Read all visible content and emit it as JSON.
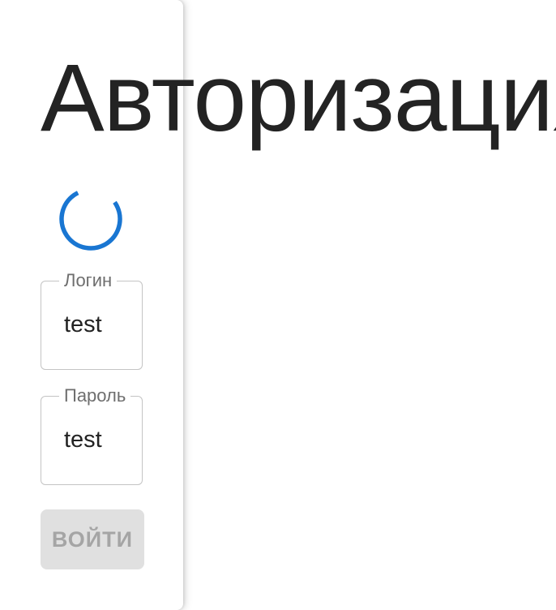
{
  "page": {
    "title": "Авторизация"
  },
  "form": {
    "login": {
      "label": "Логин",
      "value": "test"
    },
    "password": {
      "label": "Пароль",
      "value": "test"
    },
    "submit_label": "ВОЙТИ",
    "submit_disabled": true,
    "loading": true
  },
  "colors": {
    "spinner": "#1976d2",
    "title_text": "#232323",
    "field_border": "#c4c4c4",
    "label_text": "#6e6e6e",
    "disabled_button_bg": "#e0e0e0",
    "disabled_button_text": "#a5a5a5"
  },
  "icons": {
    "spinner": "loading-spinner-icon"
  }
}
